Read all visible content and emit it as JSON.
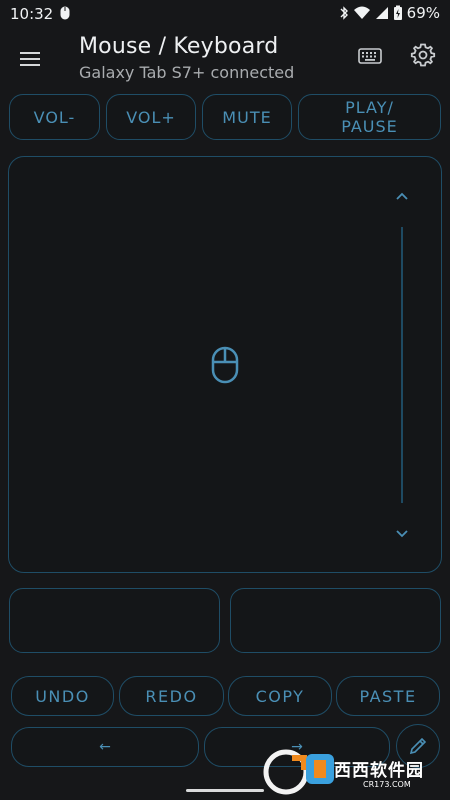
{
  "status": {
    "time": "10:32",
    "battery": "69%"
  },
  "appbar": {
    "title": "Mouse / Keyboard",
    "subtitle": "Galaxy Tab S7+ connected"
  },
  "media_buttons": {
    "vol_down": "VOL-",
    "vol_up": "VOL+",
    "mute": "MUTE",
    "play_pause_line1": "PLAY/",
    "play_pause_line2": "PAUSE"
  },
  "edit_buttons": {
    "undo": "UNDO",
    "redo": "REDO",
    "copy": "COPY",
    "paste": "PASTE"
  },
  "arrow_buttons": {
    "left": "←",
    "right": "→"
  },
  "watermark": {
    "brand": "西西软件园",
    "domain": "CR173.COM"
  },
  "colors": {
    "background": "#161719",
    "accent": "#4a8fb5",
    "border": "#1f4d66"
  }
}
